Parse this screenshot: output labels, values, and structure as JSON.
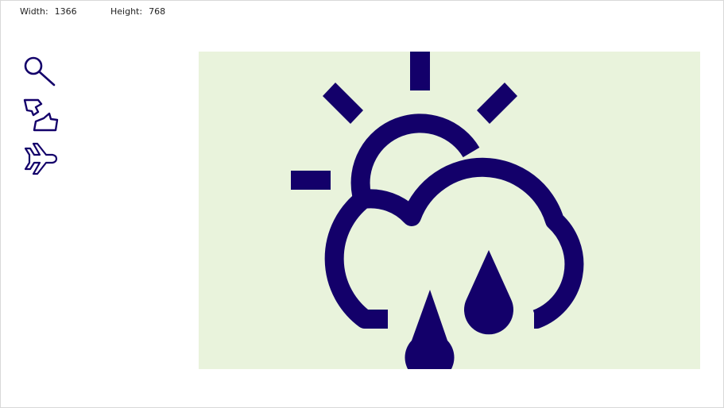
{
  "readouts": {
    "width_label": "Width:",
    "width_value": "1366",
    "height_label": "Height:",
    "height_value": "768"
  },
  "colors": {
    "icon": "#13006a",
    "stage_bg": "#e9f3dc",
    "page_bg": "#ffffff",
    "frame_border": "#d8d8d8"
  },
  "toolbar": {
    "icons": [
      "search-icon",
      "thumbs-up-down-icon",
      "airplane-icon"
    ]
  },
  "stage": {
    "icon": "partly-cloudy-rain-icon"
  }
}
